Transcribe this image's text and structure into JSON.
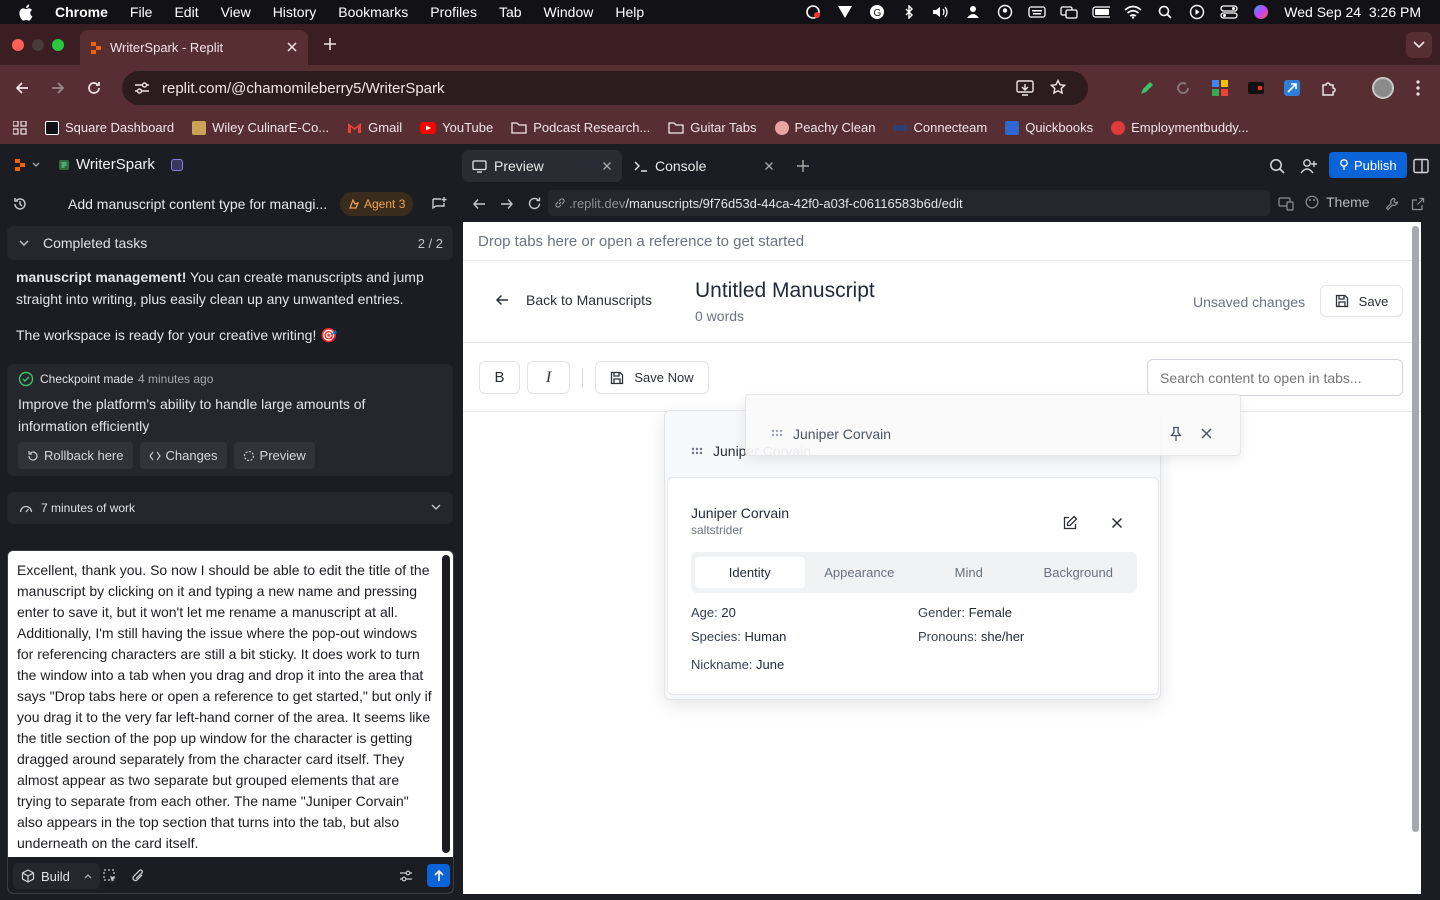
{
  "menubar": {
    "app": "Chrome",
    "items": [
      "File",
      "Edit",
      "View",
      "History",
      "Bookmarks",
      "Profiles",
      "Tab",
      "Window",
      "Help"
    ],
    "datetime": "Wed Sep 24  3:26 PM"
  },
  "browser": {
    "tab_title": "WriterSpark - Replit",
    "url": "replit.com/@chamomileberry5/WriterSpark",
    "bookmarks": [
      {
        "label": "Square Dashboard",
        "color": "#111111"
      },
      {
        "label": "Wiley CulinarE-Co...",
        "color": "#c9a35a"
      },
      {
        "label": "Gmail",
        "color": "#ea4335"
      },
      {
        "label": "YouTube",
        "color": "#ff0000"
      },
      {
        "label": "Podcast Research...",
        "color": "folder"
      },
      {
        "label": "Guitar Tabs",
        "color": "folder"
      },
      {
        "label": "Peachy Clean",
        "color": "#e9a3a0"
      },
      {
        "label": "Connecteam",
        "color": "#2c3e72"
      },
      {
        "label": "Quickbooks",
        "color": "#2f66d4"
      },
      {
        "label": "Employmentbuddy...",
        "color": "#e03a3a"
      }
    ]
  },
  "replit": {
    "project": "WriterSpark",
    "agent_title": "Add manuscript content type for managi...",
    "agent_badge": "Agent 3",
    "completed_label": "Completed tasks",
    "completed_count": "2 / 2",
    "message_bold": "manuscript management!",
    "message_rest": " You can create manuscripts and jump straight into writing, plus easily clean up any unwanted entries.",
    "message_2": "The workspace is ready for your creative writing! 🎯",
    "checkpoint_label": "Checkpoint made",
    "checkpoint_time": "4 minutes ago",
    "checkpoint_text": "Improve the platform's ability to handle large amounts of information efficiently",
    "rollback_label": "Rollback here",
    "changes_label": "Changes",
    "preview_label": "Preview",
    "work_label": "7 minutes of work",
    "input_text": "Excellent, thank you. So now I should be able to edit the title of the manuscript by clicking on it and typing a new name and pressing enter to save it, but it won't let me rename a manuscript at all. Additionally, I'm still having the issue where the pop-out windows for referencing characters are still a bit sticky. It does work to turn the window into a tab when you drag and drop it into the area that says \"Drop tabs here or open a reference to get started,\" but only if you drag it to the very far left-hand corner of the area. It seems like the title section of the pop up window for the character is getting dragged around separately from the character card itself. They almost appear as two separate but grouped elements that are trying to separate from each other. The name \"Juniper Corvain\" also appears in the top section that turns into the tab, but also underneath on the card itself.",
    "build_label": "Build"
  },
  "workspace": {
    "tab_preview": "Preview",
    "tab_console": "Console",
    "publish_label": "Publish",
    "url_domain": ".replit.dev",
    "url_path": "/manuscripts/9f76d53d-44ca-42f0-a03f-c06116583b6d/edit",
    "theme_label": "Theme"
  },
  "app": {
    "dropzone": "Drop tabs here or open a reference to get started",
    "back_label": "Back to Manuscripts",
    "title": "Untitled Manuscript",
    "word_count": "0 words",
    "unsaved": "Unsaved changes",
    "save_label": "Save",
    "bold_label": "B",
    "italic_label": "I",
    "save_now_label": "Save Now",
    "search_placeholder": "Search content to open in tabs...",
    "drag_header_name": "Juniper Corvain",
    "behind_header_name": "Juniper Corvain",
    "card": {
      "name": "Juniper Corvain",
      "subtitle": "saltstrider",
      "tabs": [
        "Identity",
        "Appearance",
        "Mind",
        "Background"
      ],
      "active_tab": "Identity",
      "age_label": "Age:",
      "age": "20",
      "gender_label": "Gender:",
      "gender": "Female",
      "species_label": "Species:",
      "species": "Human",
      "pronouns_label": "Pronouns:",
      "pronouns": "she/her",
      "nickname_label": "Nickname:",
      "nickname": "June"
    }
  }
}
